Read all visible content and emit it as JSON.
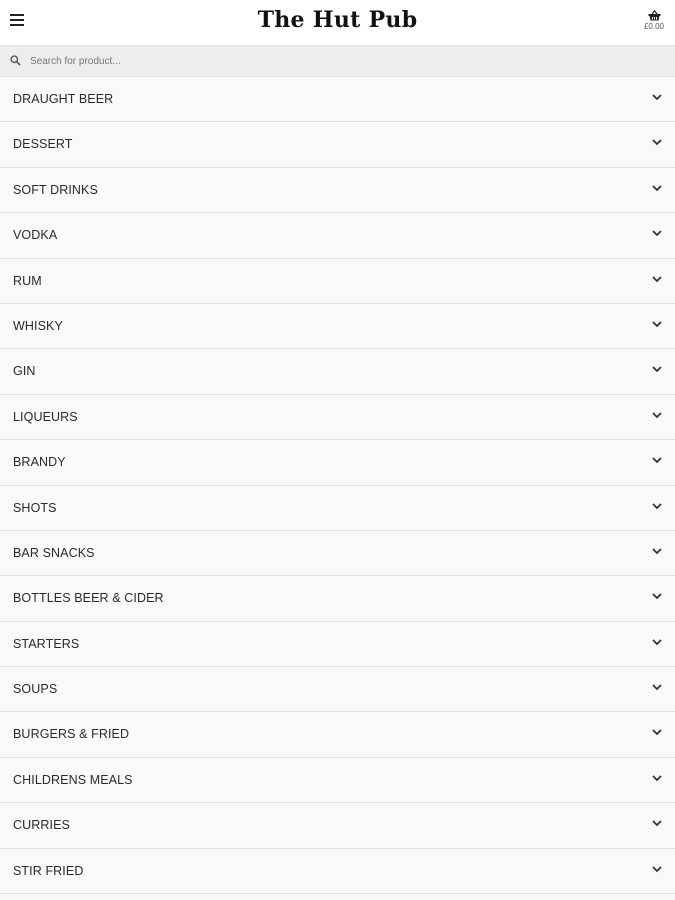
{
  "header": {
    "title": "The Hut Pub",
    "menu_icon": "hamburger-menu-icon",
    "basket_icon": "shopping-basket-icon",
    "basket_total": "£0.00"
  },
  "search": {
    "placeholder": "Search for product...",
    "value": "",
    "icon": "search-icon"
  },
  "categories": [
    {
      "label": "DRAUGHT BEER"
    },
    {
      "label": "DESSERT"
    },
    {
      "label": "SOFT DRINKS"
    },
    {
      "label": "VODKA"
    },
    {
      "label": "RUM"
    },
    {
      "label": "WHISKY"
    },
    {
      "label": "GIN"
    },
    {
      "label": "LIQUEURS"
    },
    {
      "label": "BRANDY"
    },
    {
      "label": "SHOTS"
    },
    {
      "label": "BAR SNACKS"
    },
    {
      "label": "BOTTLES BEER & CIDER"
    },
    {
      "label": "STARTERS"
    },
    {
      "label": "SOUPS"
    },
    {
      "label": "BURGERS & FRIED"
    },
    {
      "label": "CHILDRENS MEALS"
    },
    {
      "label": "CURRIES"
    },
    {
      "label": "STIR FRIED"
    }
  ],
  "colors": {
    "header_bg": "#ffffff",
    "search_bg": "#ededed",
    "row_bg": "#f9f9f9",
    "divider": "#e3e3e3",
    "text": "#2a2a2a"
  }
}
